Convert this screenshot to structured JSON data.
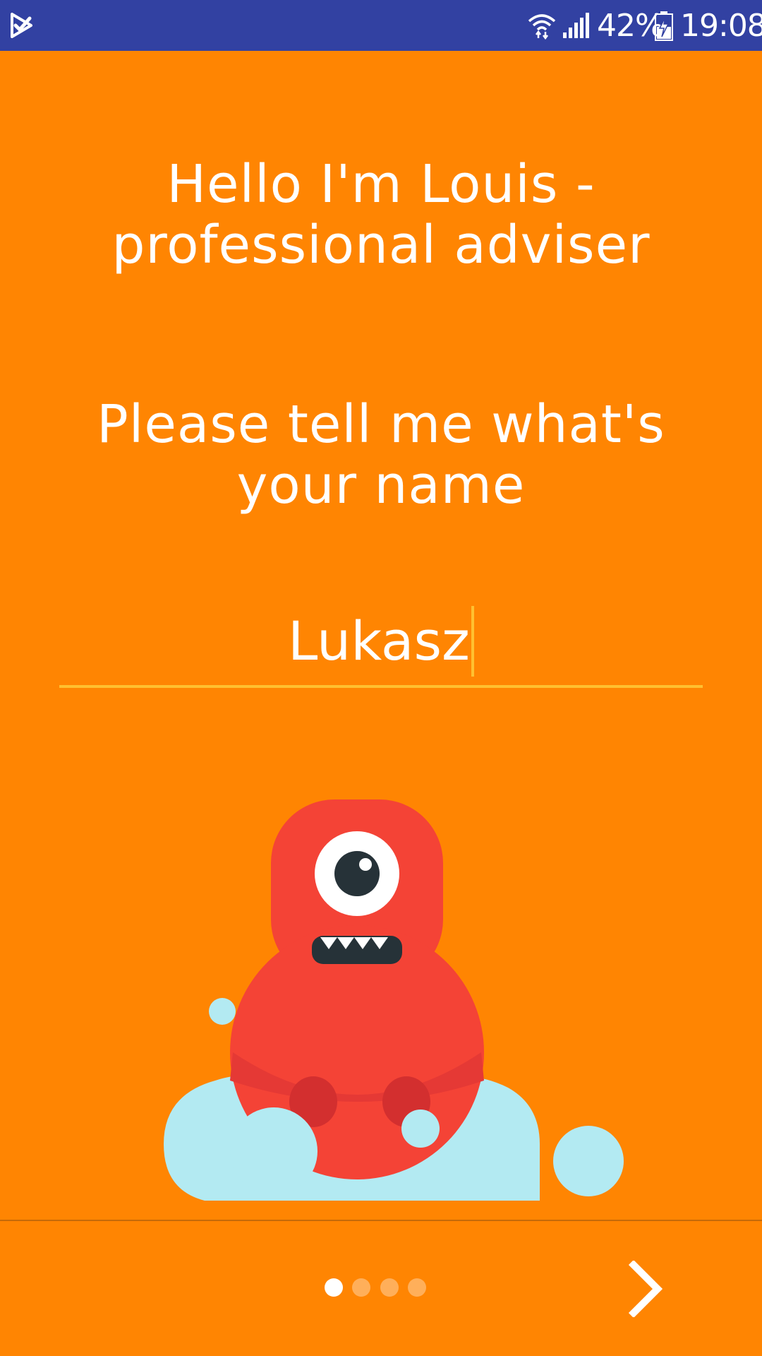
{
  "status_bar": {
    "battery_percent": "42%",
    "time": "19:08",
    "icons": [
      "app-check-icon",
      "wifi-icon",
      "signal-icon",
      "battery-charging-icon"
    ]
  },
  "onboarding": {
    "greeting": "Hello I'm Louis - professional adviser",
    "prompt": "Please tell me what's your name",
    "name_input": {
      "value": "Lukasz",
      "placeholder": ""
    }
  },
  "footer": {
    "page_count": 4,
    "current_page": 1,
    "next_icon": "chevron-right-icon"
  },
  "colors": {
    "background": "#FF8502",
    "status_bar": "#3241A2",
    "accent": "#FFC030",
    "mascot_body": "#F44336",
    "cloud": "#B3EAF2"
  }
}
